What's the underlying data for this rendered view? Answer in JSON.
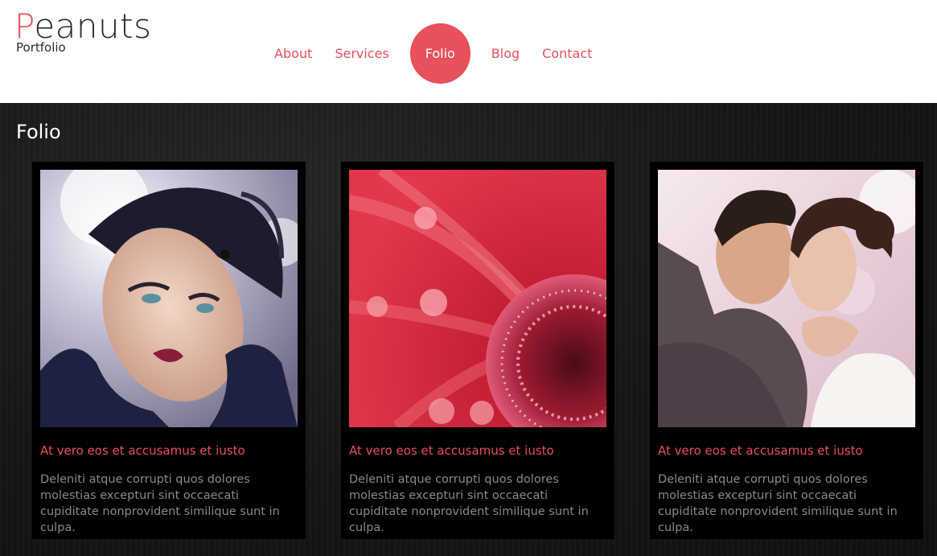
{
  "logo": {
    "first_letter": "P",
    "rest": "eanuts",
    "subtitle": "Portfolio"
  },
  "nav": {
    "items": [
      {
        "label": "About"
      },
      {
        "label": "Services"
      },
      {
        "label": "Folio",
        "active": true
      },
      {
        "label": "Blog"
      },
      {
        "label": "Contact"
      }
    ]
  },
  "section": {
    "title": "Folio"
  },
  "cards": [
    {
      "image": "woman-portrait-with-veil-hat",
      "title": "At vero eos et accusamus et iusto",
      "text": "Deleniti atque corrupti quos dolores molestias excepturi sint occaecati cupiditate nonprovident similique sunt in culpa."
    },
    {
      "image": "red-flower-macro-with-water-drops",
      "title": "At vero eos et accusamus et iusto",
      "text": "Deleniti atque corrupti quos dolores molestias excepturi sint occaecati cupiditate nonprovident similique sunt in culpa."
    },
    {
      "image": "wedding-couple-embracing",
      "title": "At vero eos et accusamus et iusto",
      "text": "Deleniti atque corrupti quos dolores molestias excepturi sint occaecati cupiditate nonprovident similique sunt in culpa."
    }
  ],
  "colors": {
    "accent": "#e8505b",
    "background": "#161616",
    "card": "#000000",
    "text_muted": "#8a8a8a"
  }
}
